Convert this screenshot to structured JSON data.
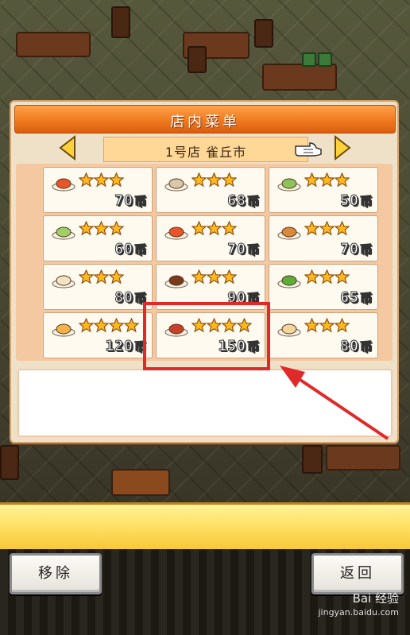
{
  "panel": {
    "title": "店内菜单",
    "store_name": "1号店 雀丘市"
  },
  "menu_items": [
    {
      "dish_icon": "pasta-dish-icon",
      "dish_color": "#e8552a",
      "stars": 3,
      "price": "70",
      "unit": "币"
    },
    {
      "dish_icon": "soup-bowl-icon",
      "dish_color": "#d8c7a8",
      "stars": 3,
      "price": "68",
      "unit": "币"
    },
    {
      "dish_icon": "salad-dish-icon",
      "dish_color": "#8cc45a",
      "stars": 3,
      "price": "50",
      "unit": "币"
    },
    {
      "dish_icon": "green-dish-icon",
      "dish_color": "#9ed06a",
      "stars": 3,
      "price": "60",
      "unit": "币"
    },
    {
      "dish_icon": "spaghetti-dish-icon",
      "dish_color": "#e8552a",
      "stars": 3,
      "price": "70",
      "unit": "币"
    },
    {
      "dish_icon": "fried-dish-icon",
      "dish_color": "#d8893a",
      "stars": 3,
      "price": "70",
      "unit": "币"
    },
    {
      "dish_icon": "cream-dish-icon",
      "dish_color": "#f1e4c2",
      "stars": 3,
      "price": "80",
      "unit": "币"
    },
    {
      "dish_icon": "steak-dish-icon",
      "dish_color": "#7a3a1e",
      "stars": 3,
      "price": "90",
      "unit": "币"
    },
    {
      "dish_icon": "vegetable-dish-icon",
      "dish_color": "#5cae3a",
      "stars": 3,
      "price": "65",
      "unit": "币"
    },
    {
      "dish_icon": "omelette-dish-icon",
      "dish_color": "#f3b34a",
      "stars": 4,
      "price": "120",
      "unit": "币"
    },
    {
      "dish_icon": "ramen-bowl-icon",
      "dish_color": "#c8402a",
      "stars": 4,
      "price": "150",
      "unit": "币"
    },
    {
      "dish_icon": "dumpling-dish-icon",
      "dish_color": "#f0d7a0",
      "stars": 3,
      "price": "80",
      "unit": "币"
    }
  ],
  "buttons": {
    "remove": "移除",
    "back": "返回"
  },
  "watermark": {
    "brand": "Bai 经验",
    "url": "jingyan.baidu.com"
  },
  "colors": {
    "header_orange": "#f07a1e",
    "star_gold": "#ffb81e",
    "highlight_red": "#e02a2a"
  }
}
